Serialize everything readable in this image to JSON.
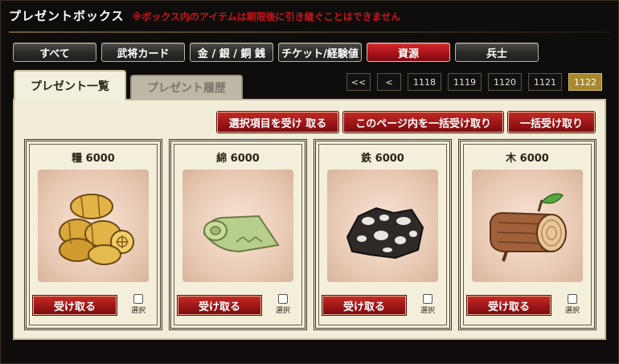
{
  "header": {
    "title": "プレゼントボックス",
    "notice": "※ボックス内のアイテムは期限後に引き継ぐことはできません"
  },
  "categories": [
    {
      "label": "すべて",
      "active": false
    },
    {
      "label": "武将カード",
      "active": false
    },
    {
      "label": "金 / 銀 / 銅 銭",
      "active": false
    },
    {
      "label": "チケット/経験値",
      "active": false
    },
    {
      "label": "資源",
      "active": true
    },
    {
      "label": "兵士",
      "active": false
    }
  ],
  "tabs": {
    "list": "プレゼント一覧",
    "history": "プレゼント履歴"
  },
  "pager": {
    "first": "<<",
    "prev": "<",
    "pages": [
      "1118",
      "1119",
      "1120",
      "1121",
      "1122"
    ],
    "current": "1122"
  },
  "actions": {
    "receive_selected": "選択項目を受け 取る",
    "receive_page": "このページ内を一括受け取り",
    "receive_all": "一括受け取り"
  },
  "items": [
    {
      "name": "糧 6000",
      "icon": "rice-bales-icon",
      "button": "受け取る",
      "select_label": "選択"
    },
    {
      "name": "綿 6000",
      "icon": "cotton-cloth-icon",
      "button": "受け取る",
      "select_label": "選択"
    },
    {
      "name": "鉄 6000",
      "icon": "iron-ore-icon",
      "button": "受け取る",
      "select_label": "選択"
    },
    {
      "name": "木 6000",
      "icon": "wood-log-icon",
      "button": "受け取る",
      "select_label": "選択"
    }
  ],
  "colors": {
    "accent_red": "#a8121a",
    "current_page": "#a8892e",
    "panel_bg": "#f1edd8"
  }
}
